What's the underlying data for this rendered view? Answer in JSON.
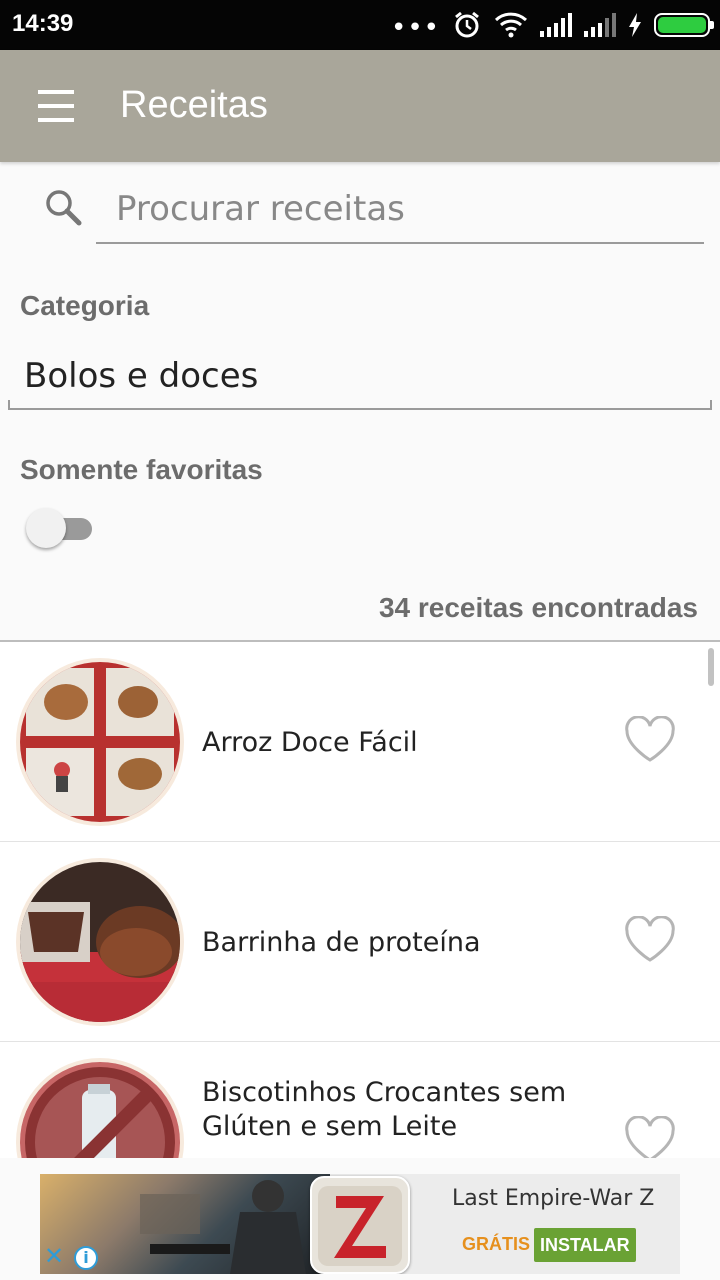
{
  "status_bar": {
    "time": "14:39",
    "icons": [
      "more-dots-icon",
      "alarm-icon",
      "wifi-icon",
      "signal-icon",
      "signal-icon",
      "charging-icon",
      "battery-icon"
    ]
  },
  "app_bar": {
    "title": "Receitas",
    "menu_icon": "hamburger-menu-icon",
    "color": "#a9a69a"
  },
  "search": {
    "placeholder": "Procurar receitas",
    "value": "",
    "icon": "search-icon"
  },
  "category": {
    "label": "Categoria",
    "selected": "Bolos e doces"
  },
  "favorites_filter": {
    "label": "Somente favoritas",
    "enabled": false
  },
  "results_count": "34 receitas encontradas",
  "recipes": [
    {
      "name": "Arroz Doce Fácil",
      "favorite": false
    },
    {
      "name": "Barrinha de proteína",
      "favorite": false
    },
    {
      "name": "Biscotinhos Crocantes sem Glúten e sem Leite",
      "favorite": false
    }
  ],
  "ad": {
    "title": "Last Empire-War Z",
    "price_label": "GRÁTIS",
    "install_label": "INSTALAR",
    "close_icon": "close-icon",
    "info_icon": "info-icon",
    "accent_color": "#6aa234"
  }
}
